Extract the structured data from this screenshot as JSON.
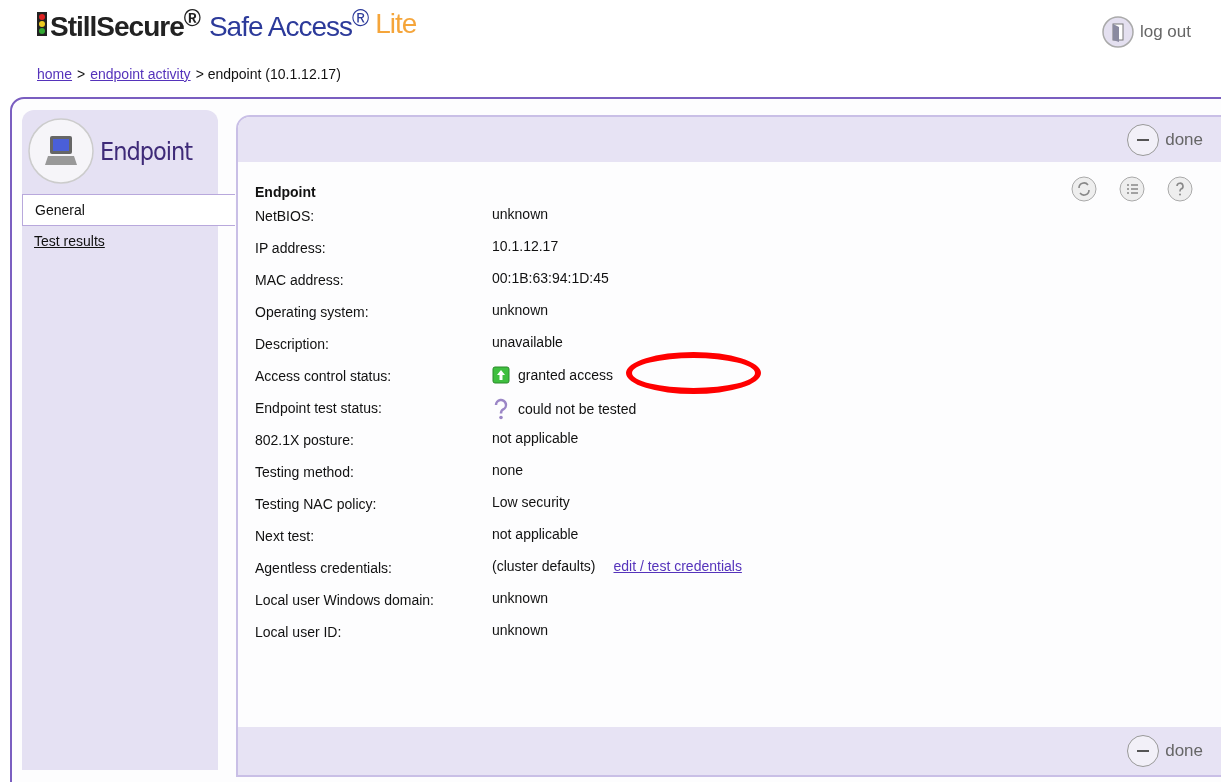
{
  "logo": {
    "brand": "StillSecure$^{®}$",
    "product": "Safe Access$^{®}$",
    "edition": "Lite"
  },
  "logout": {
    "label": "log out"
  },
  "breadcrumb": [
    {
      "text": "home",
      "link": true
    },
    {
      "text": ">",
      "link": false
    },
    {
      "text": "endpoint activity",
      "link": true
    },
    {
      "text": "> endpoint (10.1.12.17)",
      "link": false
    }
  ],
  "sidebar": {
    "title": "Endpoint",
    "items": [
      {
        "label": "General",
        "selected": true
      },
      {
        "label": "Test results",
        "selected": false
      }
    ]
  },
  "panel": {
    "done_top": "done",
    "done_bottom": "done",
    "section_title": "Endpoint",
    "rows": [
      {
        "label": "NetBIOS:",
        "value": "unknown"
      },
      {
        "label": "IP address:",
        "value": "10.1.12.17"
      },
      {
        "label": "MAC address:",
        "value": "00:1B:63:94:1D:45"
      },
      {
        "label": "Operating system:",
        "value": "unknown"
      },
      {
        "label": "Description:",
        "value": "unavailable"
      },
      {
        "label": "Access control status:",
        "value": "granted access",
        "kind": "granted",
        "annotated": true
      },
      {
        "label": "Endpoint test status:",
        "value": "could not be tested",
        "kind": "unknown"
      },
      {
        "label": "802.1X posture:",
        "value": "not applicable"
      },
      {
        "label": "Testing method:",
        "value": "none"
      },
      {
        "label": "Testing NAC policy:",
        "value": "Low security"
      },
      {
        "label": "Next test:",
        "value": "not applicable"
      },
      {
        "label": "Agentless credentials:",
        "value": "(cluster defaults)",
        "link": "edit / test credentials"
      },
      {
        "label": "Local user Windows domain:",
        "value": "unknown"
      },
      {
        "label": "Local user ID:",
        "value": "unknown"
      }
    ]
  }
}
